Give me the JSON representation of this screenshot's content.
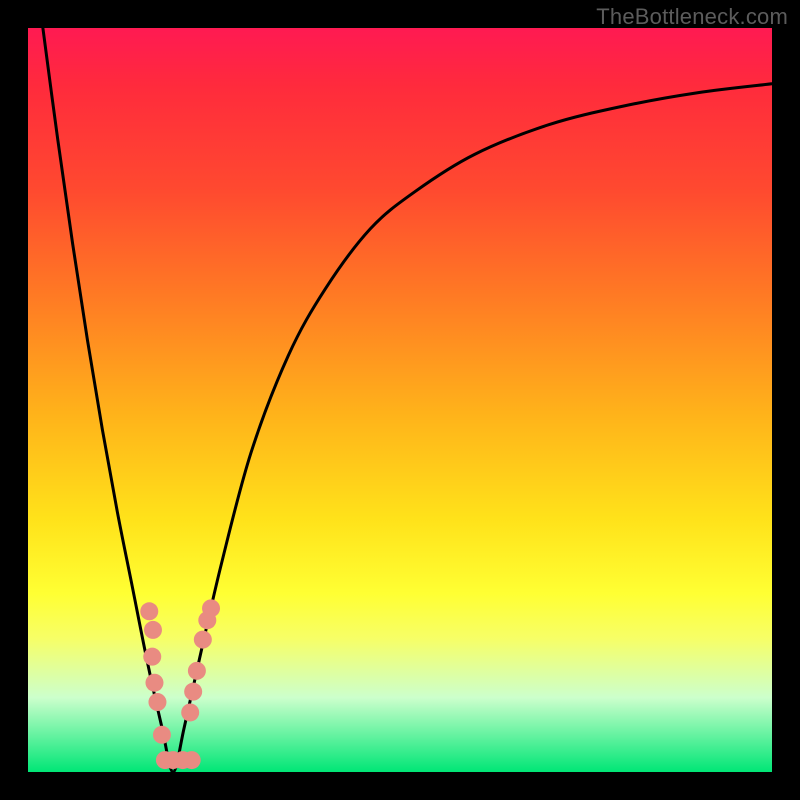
{
  "watermark": "TheBottleneck.com",
  "chart_data": {
    "type": "line",
    "title": "",
    "xlabel": "",
    "ylabel": "",
    "xlim": [
      0,
      100
    ],
    "ylim": [
      0,
      100
    ],
    "gradient_colors": {
      "top": "#ff1a52",
      "bottom": "#00e676"
    },
    "series": [
      {
        "name": "curve",
        "x": [
          2,
          4,
          6,
          8,
          10,
          12,
          14,
          16,
          18,
          19.5,
          21,
          23,
          26,
          30,
          35,
          40,
          46,
          52,
          60,
          70,
          80,
          90,
          100
        ],
        "y": [
          100,
          85,
          71,
          58,
          46,
          35,
          25,
          15,
          6,
          0,
          6,
          15,
          28,
          43,
          56,
          65,
          73,
          78,
          83,
          87,
          89.5,
          91.3,
          92.5
        ]
      }
    ],
    "markers": {
      "name": "dots",
      "color": "#e98b82",
      "radius": 9,
      "points": [
        {
          "x": 16.3,
          "y": 21.6
        },
        {
          "x": 16.8,
          "y": 19.1
        },
        {
          "x": 16.7,
          "y": 15.5
        },
        {
          "x": 17.0,
          "y": 12.0
        },
        {
          "x": 17.4,
          "y": 9.4
        },
        {
          "x": 18.0,
          "y": 5.0
        },
        {
          "x": 18.4,
          "y": 1.6
        },
        {
          "x": 19.5,
          "y": 1.6
        },
        {
          "x": 20.8,
          "y": 1.6
        },
        {
          "x": 22.0,
          "y": 1.6
        },
        {
          "x": 21.8,
          "y": 8.0
        },
        {
          "x": 22.2,
          "y": 10.8
        },
        {
          "x": 22.7,
          "y": 13.6
        },
        {
          "x": 23.5,
          "y": 17.8
        },
        {
          "x": 24.1,
          "y": 20.4
        },
        {
          "x": 24.6,
          "y": 22.0
        }
      ]
    }
  }
}
